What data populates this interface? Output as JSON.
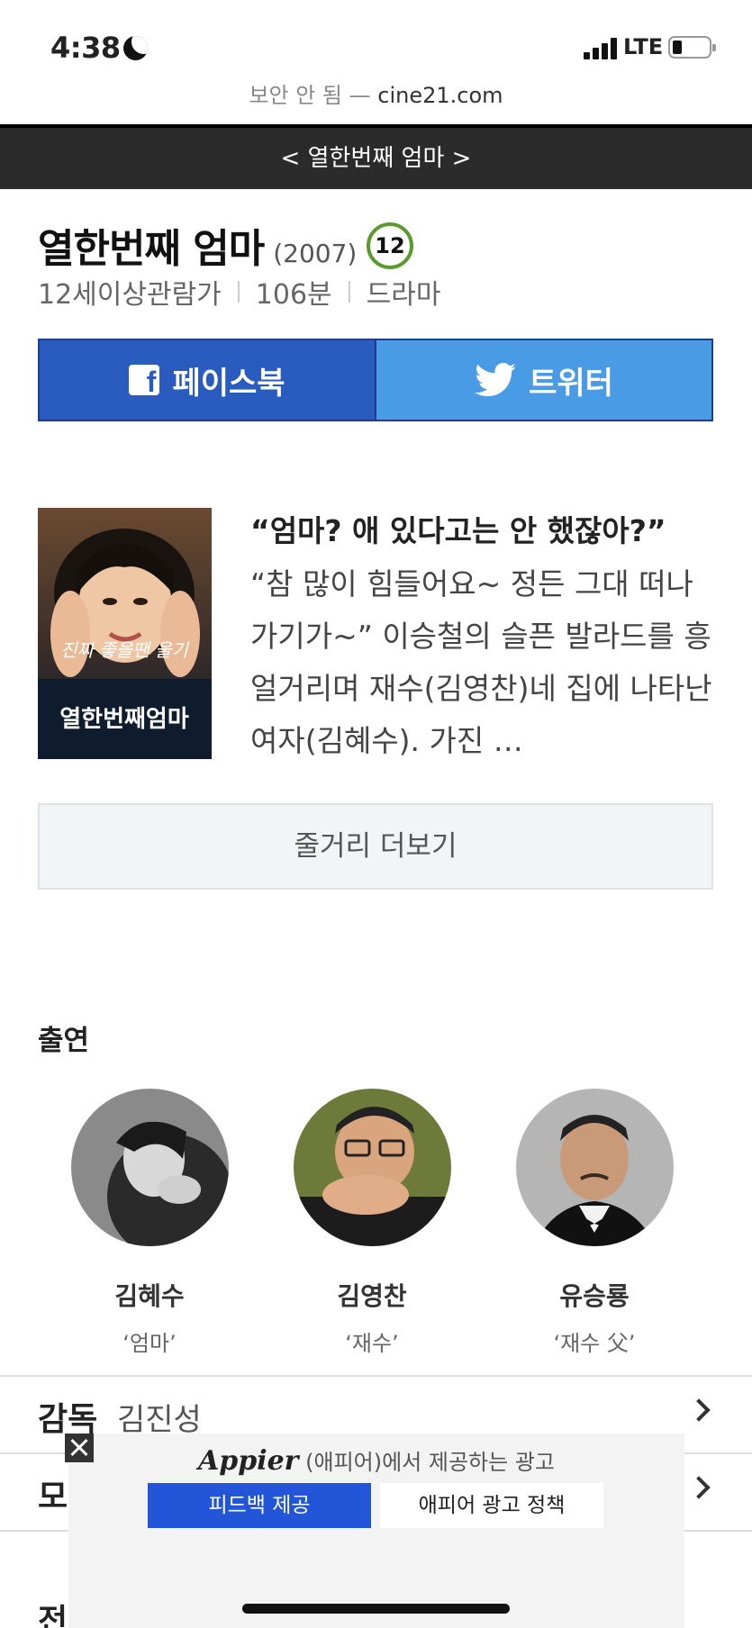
{
  "status_bar": {
    "time": "4:38",
    "network": "LTE"
  },
  "browser": {
    "insecure_label": "보안 안 됨 —",
    "domain": "cine21.com"
  },
  "nav": {
    "title": "< 열한번째 엄마 >"
  },
  "movie": {
    "title": "열한번째 엄마",
    "year": "(2007)",
    "rating_badge": "12",
    "rating_text": "12세이상관람가",
    "runtime": "106분",
    "genre": "드라마"
  },
  "share": {
    "facebook": "페이스북",
    "twitter": "트위터"
  },
  "synopsis": {
    "tagline": "“엄마? 애 있다고는 안 했잖아?”",
    "text": "“참 많이 힘들어요~ 정든 그대 떠나가기가~” 이승철의 슬픈 발라드를 흥얼거리며 재수(김영찬)네 집에 나타난 여자(김혜수). 가진 …",
    "more_label": "줄거리 더보기"
  },
  "poster": {
    "text_top": "진짜 좋을땐 울기",
    "text_bottom": "열한번째엄마"
  },
  "cast": {
    "heading": "출연",
    "members": [
      {
        "name": "김혜수",
        "role": "‘엄마’"
      },
      {
        "name": "김영찬",
        "role": "‘재수’"
      },
      {
        "name": "유승룡",
        "role": "‘재수 父’"
      }
    ]
  },
  "info": {
    "director_label": "감독",
    "director_value": "김진성",
    "row2_label": "모",
    "row3_label": "전"
  },
  "ad": {
    "brand": "Appier",
    "text": "(애피어)에서 제공하는 광고",
    "feedback": "피드백 제공",
    "policy": "애피어 광고 정책"
  },
  "colors": {
    "facebook": "#2a5bbe",
    "twitter": "#4a9be6",
    "rating_green": "#5a9a2e",
    "nav_bg": "#2b2b2b"
  }
}
